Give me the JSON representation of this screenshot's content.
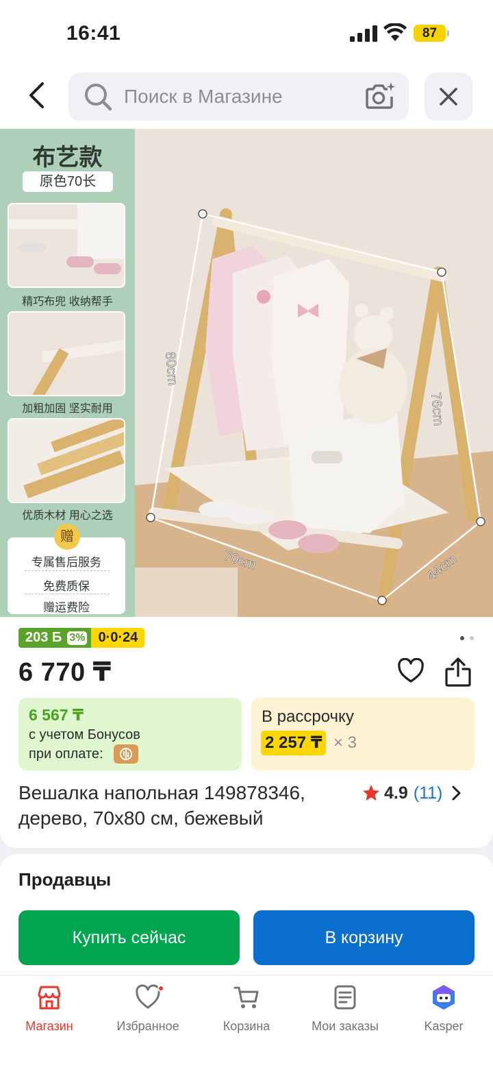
{
  "status": {
    "time": "16:41",
    "battery": "87"
  },
  "search": {
    "placeholder": "Поиск в Магазине"
  },
  "product_image": {
    "banner_title": "布艺款",
    "banner_subtitle": "原色70长",
    "feature1": "精巧布兜 收纳帮手",
    "feature2": "加粗加固 坚实耐用",
    "feature3": "优质木材 用心之选",
    "gift_badge": "赠",
    "gift1": "专属售后服务",
    "gift2": "免费质保",
    "gift3": "赠运费险",
    "dim_height": "80cm",
    "dim_side": "76cm",
    "dim_width": "70cm",
    "dim_depth": "44cm"
  },
  "badges": {
    "bonus": "203 Б",
    "bonus_pct": "3%",
    "installment": "0·0·24"
  },
  "price": "6 770 ₸",
  "bonus_box": {
    "price": "6 567 ₸",
    "line1": "с учетом Бонусов",
    "line2": "при оплате:"
  },
  "installment_box": {
    "title": "В рассрочку",
    "amount": "2 257 ₸",
    "multiplier": "× 3"
  },
  "product": {
    "title": "Вешалка напольная 149878346, дерево, 70x80 см, бежевый",
    "rating": "4.9",
    "rating_count": "(11)"
  },
  "sellers": {
    "title": "Продавцы",
    "buy_now": "Купить сейчас",
    "add_to_cart": "В корзину"
  },
  "nav": {
    "items": [
      {
        "label": "Магазин",
        "icon": "store-icon",
        "active": true
      },
      {
        "label": "Избранное",
        "icon": "heart-icon",
        "active": false
      },
      {
        "label": "Корзина",
        "icon": "cart-icon",
        "active": false
      },
      {
        "label": "Мои заказы",
        "icon": "orders-icon",
        "active": false
      },
      {
        "label": "Kasper",
        "icon": "kasper-icon",
        "active": false
      }
    ]
  },
  "colors": {
    "accent_red": "#e8362c",
    "buy_green": "#00a54f",
    "cart_blue": "#0a6fcd",
    "badge_yellow": "#ffd600"
  }
}
